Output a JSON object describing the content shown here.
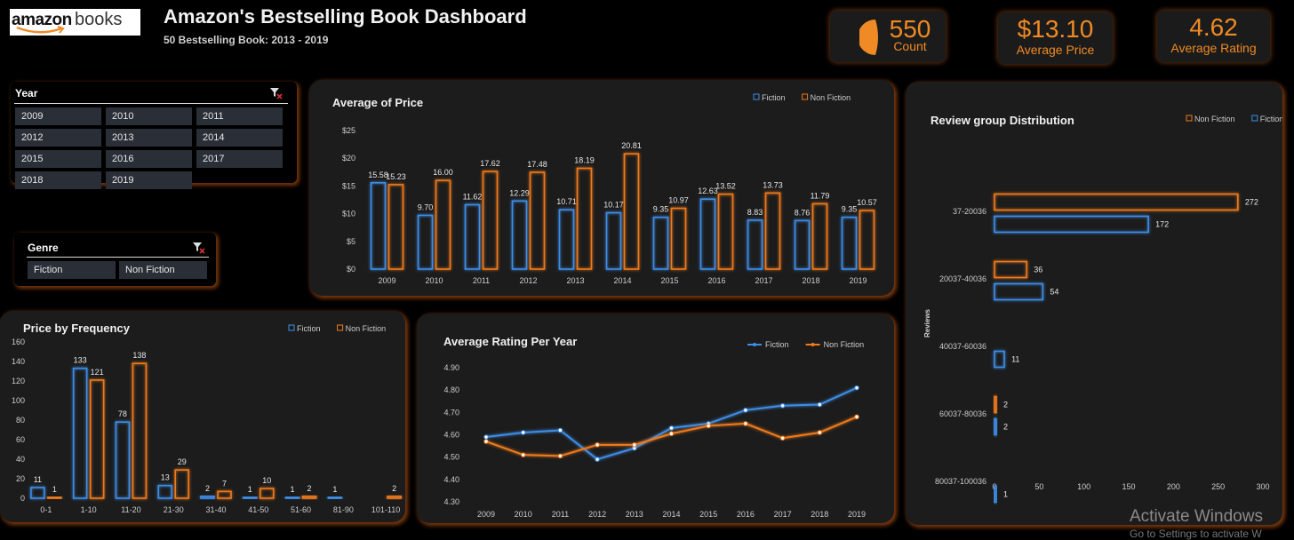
{
  "header": {
    "logo_bold": "amazon",
    "logo_light": "books",
    "title": "Amazon's Bestselling Book Dashboard",
    "subtitle": "50 Bestselling Book: 2013 - 2019"
  },
  "kpis": {
    "count_value": "550",
    "count_label": "Count",
    "price_value": "$13.10",
    "price_label": "Average Price",
    "rating_value": "4.62",
    "rating_label": "Average Rating"
  },
  "slicers": {
    "year_header": "Year",
    "years": [
      "2009",
      "2010",
      "2011",
      "2012",
      "2013",
      "2014",
      "2015",
      "2016",
      "2017",
      "2018",
      "2019"
    ],
    "genre_header": "Genre",
    "genres": [
      "Fiction",
      "Non Fiction"
    ]
  },
  "colors": {
    "fiction": "#3d8ee8",
    "nonfiction": "#f07a1a",
    "panel": "#1c1c1c"
  },
  "watermark": {
    "line1": "Activate Windows",
    "line2": "Go to Settings to activate W"
  },
  "chart_data": [
    {
      "id": "avg_price",
      "type": "bar",
      "title": "Average of Price",
      "categories": [
        "2009",
        "2010",
        "2011",
        "2012",
        "2013",
        "2014",
        "2015",
        "2016",
        "2017",
        "2018",
        "2019"
      ],
      "series": [
        {
          "name": "Fiction",
          "values": [
            15.58,
            9.7,
            11.62,
            12.29,
            10.71,
            10.17,
            9.35,
            12.63,
            8.83,
            8.76,
            9.35
          ]
        },
        {
          "name": "Non Fiction",
          "values": [
            15.23,
            16.0,
            17.62,
            17.48,
            18.19,
            20.81,
            10.97,
            13.52,
            13.73,
            11.79,
            10.57
          ]
        }
      ],
      "labels": [
        [
          "15.58",
          "9.70",
          "11.62",
          "12.29",
          "10.71",
          "10.17",
          "9.35",
          "12.63",
          "8.83",
          "8.76",
          "9.35"
        ],
        [
          "15.23",
          "16.00",
          "17.62",
          "17.48",
          "18.19",
          "20.81",
          "10.97",
          "13.52",
          "13.73",
          "11.79",
          "10.57"
        ]
      ],
      "ylim": [
        0,
        25
      ],
      "yticks": [
        0,
        5,
        10,
        15,
        20,
        25
      ],
      "ytick_labels": [
        "$0",
        "$5",
        "$10",
        "$15",
        "$20",
        "$25"
      ],
      "legend": "top-right"
    },
    {
      "id": "price_freq",
      "type": "bar",
      "title": "Price by Frequency",
      "categories": [
        "0-1",
        "1-10",
        "11-20",
        "21-30",
        "31-40",
        "41-50",
        "51-60",
        "81-90",
        "101-110"
      ],
      "series": [
        {
          "name": "Fiction",
          "values": [
            11,
            133,
            78,
            13,
            2,
            1,
            1,
            1,
            0
          ]
        },
        {
          "name": "Non Fiction",
          "values": [
            1,
            121,
            138,
            29,
            7,
            10,
            2,
            0,
            2
          ]
        }
      ],
      "labels": [
        [
          "11",
          "133",
          "78",
          "13",
          "2",
          "1",
          "1",
          "1",
          ""
        ],
        [
          "1",
          "121",
          "138",
          "29",
          "7",
          "10",
          "2",
          "",
          "2"
        ]
      ],
      "ylim": [
        0,
        160
      ],
      "yticks": [
        0,
        20,
        40,
        60,
        80,
        100,
        120,
        140,
        160
      ],
      "ytick_labels": [
        "0",
        "20",
        "40",
        "60",
        "80",
        "100",
        "120",
        "140",
        "160"
      ],
      "legend": "top-right"
    },
    {
      "id": "avg_rating",
      "type": "line",
      "title": "Average Rating Per Year",
      "x": [
        "2009",
        "2010",
        "2011",
        "2012",
        "2013",
        "2014",
        "2015",
        "2016",
        "2017",
        "2018",
        "2019"
      ],
      "series": [
        {
          "name": "Fiction",
          "values": [
            4.59,
            4.61,
            4.62,
            4.49,
            4.54,
            4.63,
            4.65,
            4.71,
            4.73,
            4.735,
            4.81
          ]
        },
        {
          "name": "Non Fiction",
          "values": [
            4.57,
            4.51,
            4.505,
            4.555,
            4.555,
            4.605,
            4.64,
            4.65,
            4.585,
            4.61,
            4.68
          ]
        }
      ],
      "ylim": [
        4.3,
        4.9
      ],
      "yticks": [
        4.3,
        4.4,
        4.5,
        4.6,
        4.7,
        4.8,
        4.9
      ],
      "ytick_labels": [
        "4.30",
        "4.40",
        "4.50",
        "4.60",
        "4.70",
        "4.80",
        "4.90"
      ],
      "legend": "top-right"
    },
    {
      "id": "review_dist",
      "type": "bar",
      "orientation": "horizontal",
      "title": "Review group Distribution",
      "ylabel": "Reviews",
      "categories": [
        "37-20036",
        "20037-40036",
        "40037-60036",
        "60037-80036",
        "80037-100036"
      ],
      "series": [
        {
          "name": "Non Fiction",
          "values": [
            272,
            36,
            0,
            2,
            0
          ]
        },
        {
          "name": "Fiction",
          "values": [
            172,
            54,
            11,
            2,
            1
          ]
        }
      ],
      "labels": [
        [
          "272",
          "36",
          "",
          "2",
          ""
        ],
        [
          "172",
          "54",
          "11",
          "2",
          "1"
        ]
      ],
      "xlim": [
        0,
        300
      ],
      "xticks": [
        0,
        50,
        100,
        150,
        200,
        250,
        300
      ],
      "xtick_labels": [
        "0",
        "50",
        "100",
        "150",
        "200",
        "250",
        "300"
      ],
      "legend": "top-right"
    }
  ]
}
